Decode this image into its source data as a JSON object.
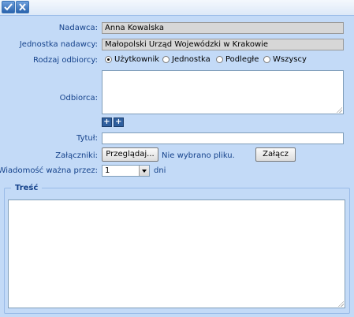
{
  "toolbar": {
    "ok_icon": "checkmark-icon",
    "cancel_icon": "close-icon"
  },
  "form": {
    "sender": {
      "label": "Nadawca:",
      "value": "Anna Kowalska"
    },
    "sender_unit": {
      "label": "Jednostka nadawcy:",
      "value": "Małopolski Urząd Wojewódzki w Krakowie"
    },
    "recipient_type": {
      "label": "Rodzaj odbiorcy:",
      "options": [
        "Użytkownik",
        "Jednostka",
        "Podległe",
        "Wszyscy"
      ],
      "selected": "Użytkownik"
    },
    "recipient": {
      "label": "Odbiorca:",
      "value": ""
    },
    "recipient_buttons": {
      "add_icon": "plus-icon",
      "add_multiple_icon": "plus-multiple-icon"
    },
    "title": {
      "label": "Tytuł:",
      "value": ""
    },
    "attachments": {
      "label": "Załączniki:",
      "browse_label": "Przeglądaj...",
      "no_file_text": "Nie wybrano pliku.",
      "attach_label": "Załącz"
    },
    "validity": {
      "label": "Wiadomość ważna przez:",
      "value": "1",
      "unit": "dni"
    }
  },
  "content": {
    "legend": "Treść",
    "value": ""
  }
}
